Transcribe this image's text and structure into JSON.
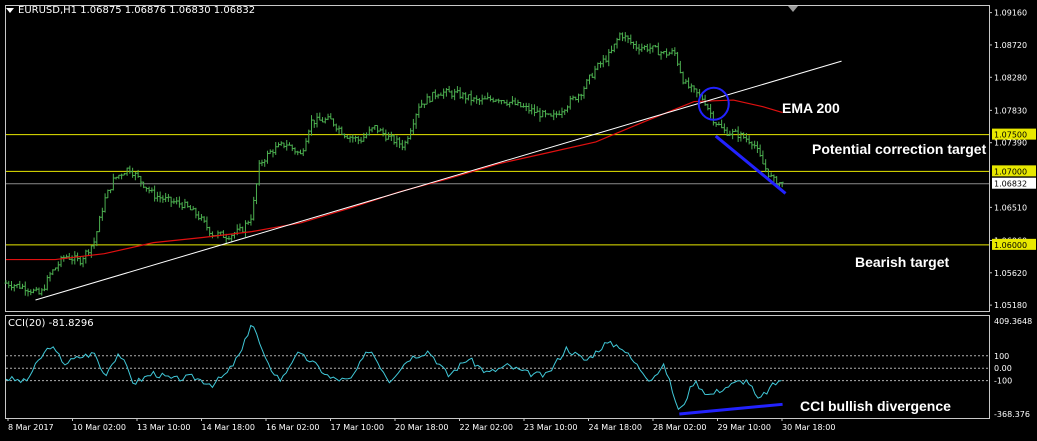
{
  "header": {
    "symbol": "EURUSD,H1",
    "ohlc": "1.06875 1.06876 1.06830 1.06832"
  },
  "cci_header": {
    "label": "CCI(20) -81.8296"
  },
  "colors": {
    "background": "#000000",
    "candles": "#4caf50",
    "ema": "#e01010",
    "trendline": "#ffffff",
    "levels": "#e8e800",
    "current_price_line": "#8a8a8a",
    "annotation": "#2222ff",
    "cci": "#40c8d8"
  },
  "annotations": {
    "ema": "EMA 200",
    "correction": "Potential correction target",
    "bearish": "Bearish target",
    "divergence": "CCI bullish divergence"
  },
  "chart_data": [
    {
      "type": "line",
      "name_shown": "EURUSD,H1",
      "ylim": [
        1.051,
        1.0925
      ],
      "y_ticks": [
        "1.09160",
        "1.08720",
        "1.08280",
        "1.07830",
        "1.07390",
        "1.06510",
        "1.06060",
        "1.05620",
        "1.05180"
      ],
      "y_ticks_values": [
        1.0916,
        1.0872,
        1.0828,
        1.0783,
        1.0739,
        1.0651,
        1.0606,
        1.0562,
        1.0518
      ],
      "levels": [
        {
          "label": "1.07500",
          "value": 1.075
        },
        {
          "label": "1.07000",
          "value": 1.07
        },
        {
          "label": "1.06000",
          "value": 1.06
        }
      ],
      "current_price": {
        "label": "1.06832",
        "value": 1.06832
      },
      "x_labels": [
        "8 Mar 2017",
        "10 Mar 02:00",
        "13 Mar 10:00",
        "14 Mar 18:00",
        "16 Mar 02:00",
        "17 Mar 10:00",
        "20 Mar 18:00",
        "22 Mar 02:00",
        "23 Mar 10:00",
        "24 Mar 18:00",
        "28 Mar 02:00",
        "29 Mar 10:00",
        "30 Mar 18:00"
      ],
      "price_path": [
        [
          0,
          1.0548
        ],
        [
          0.02,
          1.0542
        ],
        [
          0.035,
          1.0532
        ],
        [
          0.045,
          1.056
        ],
        [
          0.06,
          1.0585
        ],
        [
          0.075,
          1.0578
        ],
        [
          0.09,
          1.0605
        ],
        [
          0.1,
          1.066
        ],
        [
          0.11,
          1.069
        ],
        [
          0.125,
          1.0705
        ],
        [
          0.135,
          1.069
        ],
        [
          0.15,
          1.0668
        ],
        [
          0.165,
          1.066
        ],
        [
          0.18,
          1.0655
        ],
        [
          0.195,
          1.064
        ],
        [
          0.21,
          1.0615
        ],
        [
          0.225,
          1.0612
        ],
        [
          0.24,
          1.062
        ],
        [
          0.25,
          1.064
        ],
        [
          0.258,
          1.071
        ],
        [
          0.27,
          1.0728
        ],
        [
          0.285,
          1.0738
        ],
        [
          0.3,
          1.0722
        ],
        [
          0.31,
          1.0768
        ],
        [
          0.33,
          1.077
        ],
        [
          0.345,
          1.075
        ],
        [
          0.36,
          1.0742
        ],
        [
          0.375,
          1.076
        ],
        [
          0.39,
          1.0745
        ],
        [
          0.405,
          1.0735
        ],
        [
          0.42,
          1.079
        ],
        [
          0.44,
          1.0808
        ],
        [
          0.46,
          1.0805
        ],
        [
          0.48,
          1.0795
        ],
        [
          0.5,
          1.08
        ],
        [
          0.52,
          1.079
        ],
        [
          0.54,
          1.078
        ],
        [
          0.555,
          1.0772
        ],
        [
          0.57,
          1.079
        ],
        [
          0.585,
          1.0808
        ],
        [
          0.6,
          1.084
        ],
        [
          0.615,
          1.086
        ],
        [
          0.625,
          1.0888
        ],
        [
          0.64,
          1.087
        ],
        [
          0.655,
          1.0868
        ],
        [
          0.67,
          1.086
        ],
        [
          0.68,
          1.0862
        ],
        [
          0.69,
          1.082
        ],
        [
          0.7,
          1.0808
        ],
        [
          0.71,
          1.0798
        ],
        [
          0.72,
          1.077
        ],
        [
          0.73,
          1.0755
        ],
        [
          0.745,
          1.075
        ],
        [
          0.76,
          1.074
        ],
        [
          0.77,
          1.071
        ],
        [
          0.78,
          1.0688
        ],
        [
          0.79,
          1.0683
        ]
      ],
      "ema_path": [
        [
          0,
          1.058
        ],
        [
          0.05,
          1.058
        ],
        [
          0.1,
          1.0588
        ],
        [
          0.15,
          1.0603
        ],
        [
          0.2,
          1.061
        ],
        [
          0.25,
          1.0618
        ],
        [
          0.3,
          1.063
        ],
        [
          0.35,
          1.065
        ],
        [
          0.4,
          1.0672
        ],
        [
          0.45,
          1.069
        ],
        [
          0.5,
          1.071
        ],
        [
          0.55,
          1.0725
        ],
        [
          0.6,
          1.074
        ],
        [
          0.65,
          1.0768
        ],
        [
          0.7,
          1.0795
        ],
        [
          0.74,
          1.0797
        ],
        [
          0.77,
          1.0788
        ],
        [
          0.79,
          1.078
        ]
      ],
      "trendline": [
        [
          0.03,
          1.0525
        ],
        [
          0.85,
          1.085
        ]
      ]
    },
    {
      "type": "line",
      "name_shown": "CCI(20) -81.8296",
      "ylim": [
        -400,
        420
      ],
      "y_ticks": [
        "409.3648",
        "100",
        "0.00",
        "-100",
        "-368.376"
      ],
      "y_ticks_values": [
        409.3648,
        100,
        0,
        -100,
        -368.376
      ],
      "levels": [
        100,
        0,
        -100
      ],
      "values_path": [
        [
          0,
          -80
        ],
        [
          0.02,
          -110
        ],
        [
          0.035,
          80
        ],
        [
          0.045,
          180
        ],
        [
          0.06,
          40
        ],
        [
          0.075,
          90
        ],
        [
          0.09,
          120
        ],
        [
          0.1,
          -60
        ],
        [
          0.115,
          130
        ],
        [
          0.13,
          -120
        ],
        [
          0.15,
          -40
        ],
        [
          0.17,
          -90
        ],
        [
          0.19,
          -70
        ],
        [
          0.21,
          -130
        ],
        [
          0.225,
          -40
        ],
        [
          0.24,
          140
        ],
        [
          0.25,
          380
        ],
        [
          0.265,
          40
        ],
        [
          0.28,
          -100
        ],
        [
          0.295,
          120
        ],
        [
          0.31,
          60
        ],
        [
          0.33,
          -80
        ],
        [
          0.35,
          -100
        ],
        [
          0.37,
          160
        ],
        [
          0.39,
          -100
        ],
        [
          0.41,
          80
        ],
        [
          0.43,
          140
        ],
        [
          0.45,
          -60
        ],
        [
          0.47,
          80
        ],
        [
          0.49,
          -40
        ],
        [
          0.51,
          20
        ],
        [
          0.53,
          -40
        ],
        [
          0.55,
          -60
        ],
        [
          0.57,
          160
        ],
        [
          0.59,
          60
        ],
        [
          0.61,
          200
        ],
        [
          0.625,
          180
        ],
        [
          0.64,
          40
        ],
        [
          0.655,
          -90
        ],
        [
          0.67,
          20
        ],
        [
          0.685,
          -360
        ],
        [
          0.7,
          -100
        ],
        [
          0.715,
          -220
        ],
        [
          0.73,
          -160
        ],
        [
          0.745,
          -110
        ],
        [
          0.755,
          -100
        ],
        [
          0.765,
          -260
        ],
        [
          0.78,
          -140
        ],
        [
          0.79,
          -82
        ]
      ],
      "divergence_line": [
        [
          0.685,
          -368
        ],
        [
          0.79,
          -290
        ]
      ]
    }
  ]
}
